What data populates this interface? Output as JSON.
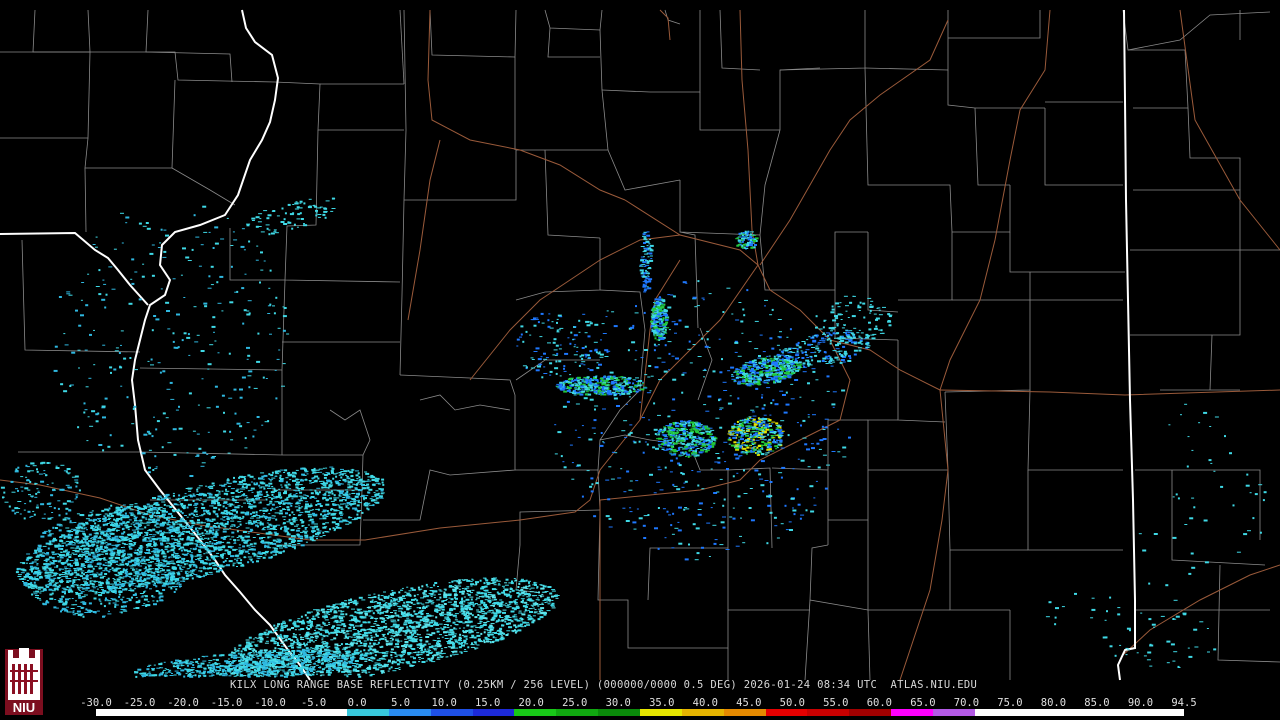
{
  "map": {
    "title": "KILX LONG RANGE BASE REFLECTIVITY (0.25KM / 256 LEVEL) (000000/0000 0.5 DEG) 2026-01-24 08:34 UTC  ATLAS.NIU.EDU",
    "logo": {
      "text": "NIU",
      "color": "#c8102e"
    },
    "colors": {
      "background": "#000000",
      "county_lines": "#8a8a8a",
      "state_lines": "#ffffff",
      "roads": "#9a5a3a",
      "echo_light": "#3fd9e6",
      "echo_blue": "#1e78ff",
      "echo_green": "#22c93a"
    },
    "legend": {
      "ticks": [
        "-30.0",
        "-25.0",
        "-20.0",
        "-15.0",
        "-10.0",
        "-5.0",
        "0.0",
        "5.0",
        "10.0",
        "15.0",
        "20.0",
        "25.0",
        "30.0",
        "35.0",
        "40.0",
        "45.0",
        "50.0",
        "55.0",
        "60.0",
        "65.0",
        "70.0",
        "75.0",
        "80.0",
        "85.0",
        "90.0",
        "94.5"
      ],
      "colors": [
        "#ffffff",
        "#ffffff",
        "#ffffff",
        "#ffffff",
        "#ffffff",
        "#ffffff",
        "#38c8dc",
        "#2a8cf0",
        "#1e50e6",
        "#1c2ad8",
        "#18c818",
        "#10a810",
        "#0a8a0a",
        "#e6e600",
        "#e6b400",
        "#e68a00",
        "#e60000",
        "#c80000",
        "#a00000",
        "#ff00ff",
        "#b45ae6",
        "#ffffff",
        "#ffffff",
        "#ffffff",
        "#ffffff",
        "#ffffff"
      ]
    }
  }
}
